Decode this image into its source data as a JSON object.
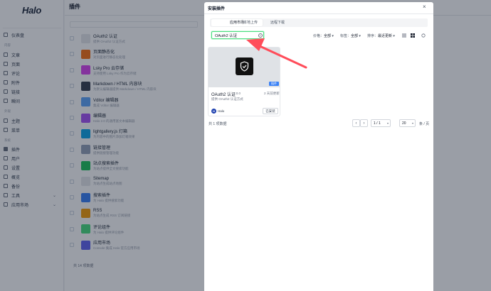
{
  "app": {
    "logo": "Halo",
    "search_placeholder": "",
    "sidebar": {
      "groups": [
        "内容",
        "外观",
        "系统"
      ],
      "items": [
        {
          "label": "仪表盘"
        },
        {
          "label": "文章"
        },
        {
          "label": "页面"
        },
        {
          "label": "评论"
        },
        {
          "label": "附件"
        },
        {
          "label": "链接"
        },
        {
          "label": "瞬间"
        },
        {
          "label": "主题"
        },
        {
          "label": "菜单"
        },
        {
          "label": "插件"
        },
        {
          "label": "用户"
        },
        {
          "label": "设置"
        },
        {
          "label": "概览"
        },
        {
          "label": "备份"
        },
        {
          "label": "工具"
        },
        {
          "label": "应用市场"
        }
      ]
    },
    "page_title": "插件",
    "list_search_placeholder": "输入关键词搜索",
    "plugins": [
      {
        "name": "OAuth2 认证",
        "desc": "提供 OAuth2 认证方式"
      },
      {
        "name": "页面静态化",
        "desc": "对页面进行静态化处理"
      },
      {
        "name": "Lsky Pro 云存储",
        "desc": "支持使用 Lsky Pro 作为云存储"
      },
      {
        "name": "Markdown / HTML 内容块",
        "desc": "为默认编辑器提供 Markdown / HTML 内容块"
      },
      {
        "name": "Vditor 编辑器",
        "desc": "集成 Vditor 编辑器"
      },
      {
        "name": "编辑器",
        "desc": "Halo 2.0 的通用富文本编辑器"
      },
      {
        "name": "lightgallery.js 灯箱",
        "desc": "为内容中的图片添加灯箱效果"
      },
      {
        "name": "链接管理",
        "desc": "提供链接管理功能"
      },
      {
        "name": "站点搜索插件",
        "desc": "为站点提供全文搜索功能"
      },
      {
        "name": "Sitemap",
        "desc": "为站点生成站点地图"
      },
      {
        "name": "搜索插件",
        "desc": "为 Halo 提供搜索功能"
      },
      {
        "name": "RSS",
        "desc": "为站点生成 RSS 订阅链接"
      },
      {
        "name": "评论组件",
        "desc": "为 Halo 提供评论组件"
      },
      {
        "name": "应用市场",
        "desc": "Console 集成 Halo 官方应用市场"
      }
    ],
    "list_total": "共 14 项数据"
  },
  "modal": {
    "title": "安装插件",
    "close_label": "×",
    "tabs": [
      {
        "label": "应用市场",
        "active": true
      },
      {
        "label": "本地上传",
        "active": false
      },
      {
        "label": "远程下载",
        "active": false
      }
    ],
    "search_value": "OAuth2 认证",
    "filters": [
      {
        "label": "价格：",
        "value": "全部"
      },
      {
        "label": "标签：",
        "value": "全部"
      },
      {
        "label": "排序：",
        "value": "最近更新"
      }
    ],
    "card": {
      "name": "OAuth2 认证",
      "version": "1.0.0",
      "updated": "2 天前更新",
      "desc": "提供 OAuth2 认证方式",
      "badge": "插件",
      "author_initial": "H",
      "author": "Halo",
      "action": "已安装"
    },
    "pagination": {
      "total": "共 1 项数据",
      "page": "1 / 1",
      "page_size": "20",
      "page_size_suffix": "条 / 页"
    }
  },
  "colors": {
    "accent": "#4ade80",
    "arrow": "#ff4d5a",
    "badge": "#3b82f6"
  }
}
